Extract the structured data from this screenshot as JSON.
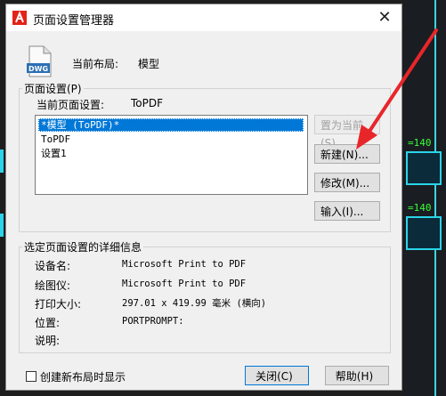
{
  "window": {
    "title": "页面设置管理器",
    "close_glyph": "✕"
  },
  "current_layout": {
    "label": "当前布局:",
    "value": "模型"
  },
  "page_setup_group": {
    "legend": "页面设置(P)",
    "current_label": "当前页面设置:",
    "current_value": "ToPDF",
    "items": [
      "*模型 (ToPDF)*",
      "ToPDF",
      "设置1"
    ],
    "selected_index": 0
  },
  "buttons": {
    "set_current": "置为当前(S)",
    "new": "新建(N)...",
    "modify": "修改(M)...",
    "import": "输入(I)...",
    "close": "关闭(C)",
    "help": "帮助(H)"
  },
  "details": {
    "legend": "选定页面设置的详细信息",
    "device_label": "设备名:",
    "device_value": "Microsoft Print to PDF",
    "plotter_label": "绘图仪:",
    "plotter_value": "Microsoft Print to PDF",
    "size_label": "打印大小:",
    "size_value": "297.01 x 419.99 毫米 (横向)",
    "location_label": "位置:",
    "location_value": "PORTPROMPT:",
    "desc_label": "说明:",
    "desc_value": ""
  },
  "checkbox": {
    "label": "创建新布局时显示",
    "checked": false
  },
  "icons": {
    "app_logo": "autocad-logo-icon",
    "file": "dwg-file-icon"
  },
  "colors": {
    "accent": "#0078d7",
    "arrow": "#e8262a",
    "cad_line": "#3ad6e0",
    "cad_text": "#37ff37"
  },
  "background_drawing": {
    "labels": [
      "=140",
      "=140"
    ]
  }
}
